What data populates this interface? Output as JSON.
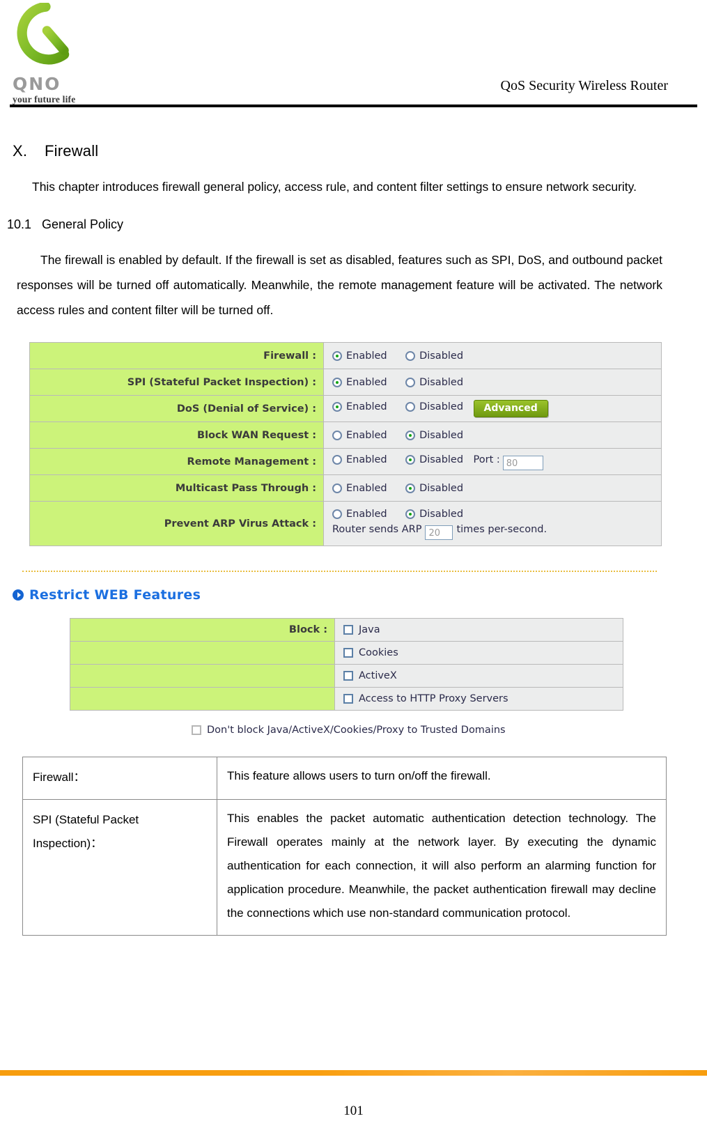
{
  "header": {
    "logo_wordmark": "QNO",
    "logo_tagline": "your future life",
    "product_title": "QoS Security Wireless Router"
  },
  "chapter": {
    "number": "X.",
    "title": "Firewall",
    "intro": "This chapter introduces firewall general policy, access rule, and content filter settings to ensure network security."
  },
  "section": {
    "number": "10.1",
    "title": "General Policy",
    "body": "The firewall is enabled by default. If the firewall is set as disabled, features such as SPI, DoS, and outbound packet responses will be turned off automatically. Meanwhile, the remote management feature will be activated. The network access rules and content filter will be turned off."
  },
  "general_policy": {
    "enabled_label": "Enabled",
    "disabled_label": "Disabled",
    "rows": [
      {
        "label": "Firewall :",
        "selected": "Enabled"
      },
      {
        "label": "SPI (Stateful Packet Inspection) :",
        "selected": "Enabled"
      },
      {
        "label": "DoS (Denial of Service) :",
        "selected": "Enabled",
        "button": "Advanced"
      },
      {
        "label": "Block WAN Request :",
        "selected": "Disabled"
      },
      {
        "label": "Remote Management :",
        "selected": "Disabled",
        "port_label": "Port :",
        "port_value": "80"
      },
      {
        "label": "Multicast Pass Through :",
        "selected": "Disabled"
      },
      {
        "label": "Prevent ARP Virus Attack :",
        "selected": "Disabled",
        "arp_prefix": "Router sends ARP",
        "arp_value": "20",
        "arp_suffix": "times per-second."
      }
    ]
  },
  "restrict_web": {
    "title": "Restrict WEB Features",
    "block_label": "Block :",
    "items": [
      "Java",
      "Cookies",
      "ActiveX",
      "Access to HTTP Proxy Servers"
    ],
    "trusted_domains": "Don't block Java/ActiveX/Cookies/Proxy to Trusted Domains"
  },
  "descriptions": [
    {
      "term": "Firewall：",
      "body": "This feature allows users to turn on/off the firewall."
    },
    {
      "term": "SPI (Stateful Packet Inspection)：",
      "body": "This enables the packet automatic authentication detection technology. The Firewall operates mainly at the network layer. By executing the dynamic authentication for each connection, it will also perform an alarming function for application procedure. Meanwhile, the packet authentication firewall may decline the connections which use non-standard communication protocol."
    }
  ],
  "footer": {
    "page_number": "101"
  },
  "colors": {
    "label_green": "#ccf37a",
    "accent_blue": "#1b6fe0",
    "footer_orange": "#f79d0e",
    "button_green": "#7ba314"
  }
}
